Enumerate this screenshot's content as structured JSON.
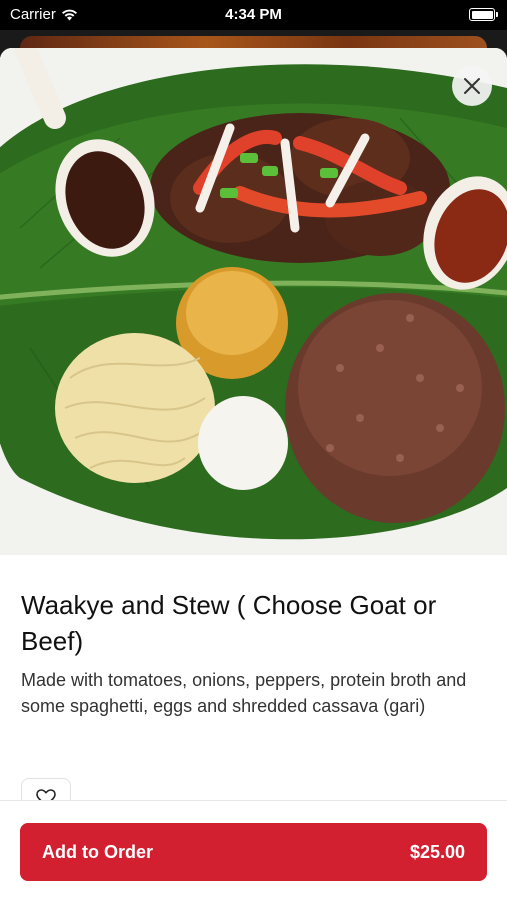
{
  "status_bar": {
    "carrier": "Carrier",
    "time": "4:34 PM",
    "icons": [
      "wifi-icon",
      "battery-icon"
    ]
  },
  "item": {
    "title": "Waakye and Stew ( Choose Goat or Beef)",
    "description": "Made with tomatoes, onions, peppers, protein broth and some spaghetti, eggs and shredded cassava (gari)",
    "image": "photo of waakye plate on banana leaf with stew meat, spaghetti, egg, gari and pepper sauce",
    "price": "$25.00"
  },
  "actions": {
    "close_icon": "close-icon",
    "favorite_icon": "heart-icon",
    "add_to_order_label": "Add to Order"
  },
  "colors": {
    "accent": "#d32030",
    "status_bar_bg": "#000000"
  }
}
